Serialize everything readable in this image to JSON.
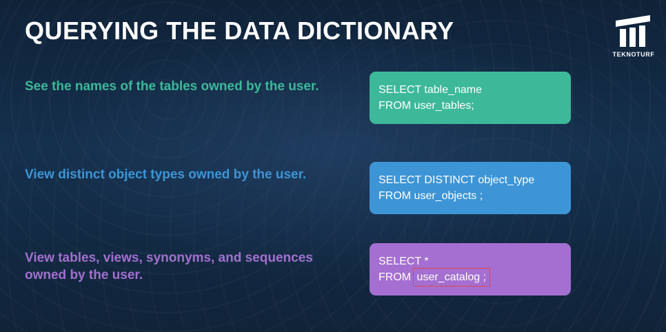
{
  "title": "QUERYING THE DATA DICTIONARY",
  "brand": {
    "name": "TEKNOTURF",
    "icon": "teknoturf-logo-icon"
  },
  "colors": {
    "teal": "#3db99a",
    "blue": "#3d95d6",
    "purple": "#a46fd0",
    "highlight_border": "#e0474c"
  },
  "rows": [
    {
      "description": "See the names of the tables owned by the user.",
      "query_lines": [
        "SELECT table_name",
        "FROM user_tables;"
      ]
    },
    {
      "description": "View distinct object types owned by the user.",
      "query_lines": [
        "SELECT DISTINCT object_type",
        "FROM user_objects ;"
      ]
    },
    {
      "description_lines": [
        "View tables, views, synonyms, and sequences",
        "owned by the user."
      ],
      "query_line_1": "SELECT *",
      "query_line_2_prefix": "FROM ",
      "query_line_2_highlight": "user_catalog ;"
    }
  ]
}
